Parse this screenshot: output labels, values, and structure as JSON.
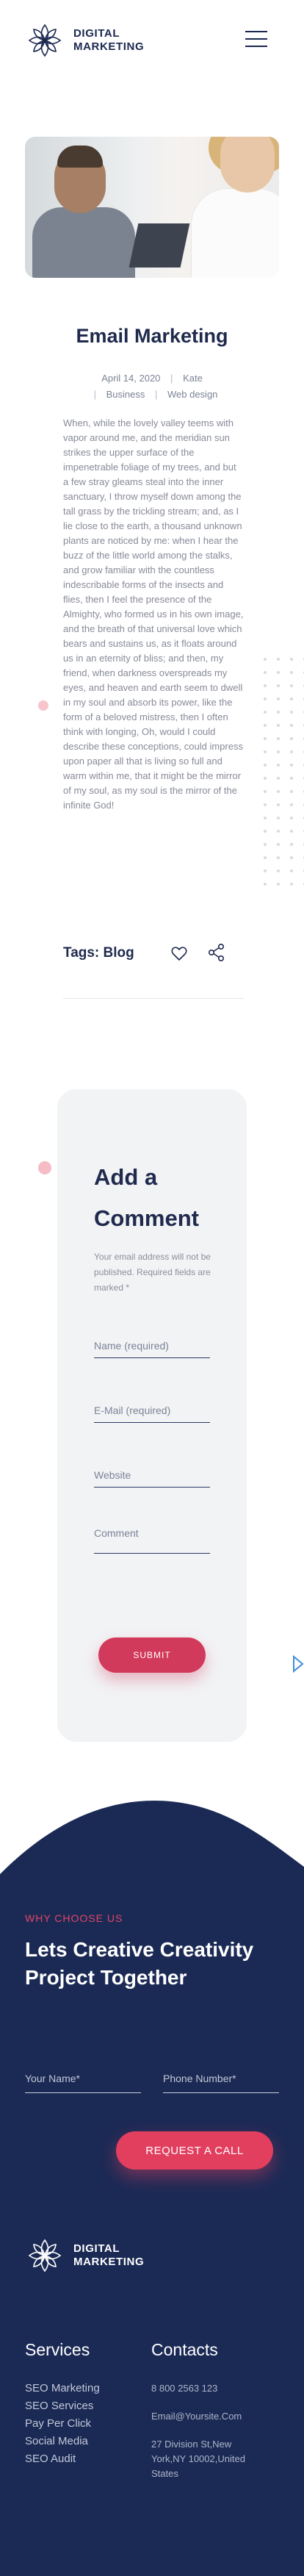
{
  "header": {
    "logo_line1": "DIGITAL",
    "logo_line2": "MARKETING",
    "menu_icon": "hamburger-menu-icon"
  },
  "article": {
    "title": "Email Marketing",
    "date": "April 14, 2020",
    "author": "Kate",
    "categories": [
      "Business",
      "Web design"
    ],
    "body": "When, while the lovely valley teems with vapor around me, and the meridian sun strikes the upper surface of the impenetrable foliage of my trees, and but a few stray gleams steal into the inner sanctuary, I throw myself down among the tall grass by the trickling stream; and, as I lie close to the earth, a thousand unknown plants are noticed by me: when I hear the buzz of the little world among the stalks, and grow familiar with the countless indescribable forms of the insects and flies, then I feel the presence of the Almighty, who formed us in his own image, and the breath of that universal love which bears and sustains us, as it floats around us in an eternity of bliss; and then, my friend, when darkness overspreads my eyes, and heaven and earth seem to dwell in my soul and absorb its power, like the form of a beloved mistress, then I often think with longing, Oh, would I could describe these conceptions, could impress upon paper all that is living so full and warm within me, that it might be the mirror of my soul, as my soul is the mirror of the infinite God!",
    "tags_label": "Tags: Blog",
    "like_icon": "heart-icon",
    "share_icon": "share-icon"
  },
  "comment": {
    "title_line1": "Add a",
    "title_line2": "Comment",
    "note": "Your email address will not be published. Required fields are marked *",
    "name_placeholder": "Name (required)",
    "email_placeholder": "E-Mail (required)",
    "website_placeholder": "Website",
    "comment_placeholder": "Comment",
    "submit_label": "SUBMIT"
  },
  "footer": {
    "eyebrow": "WHY CHOOSE US",
    "headline": "Lets Creative Creativity Project Together",
    "name_placeholder": "Your Name*",
    "phone_placeholder": "Phone Number*",
    "request_label": "REQUEST A CALL",
    "logo_line1": "DIGITAL",
    "logo_line2": "MARKETING",
    "services_title": "Services",
    "services": [
      "SEO Marketing",
      "SEO Services",
      "Pay Per Click",
      "Social Media",
      "SEO Audit"
    ],
    "contacts_title": "Contacts",
    "phone": "8 800 2563 123",
    "email": "Email@Yoursite.Com",
    "address": "27 Division St,New York,NY 10002,United States"
  },
  "colors": {
    "navy": "#1b2a55",
    "accent": "#e23f5f",
    "text_muted": "#878a99"
  }
}
